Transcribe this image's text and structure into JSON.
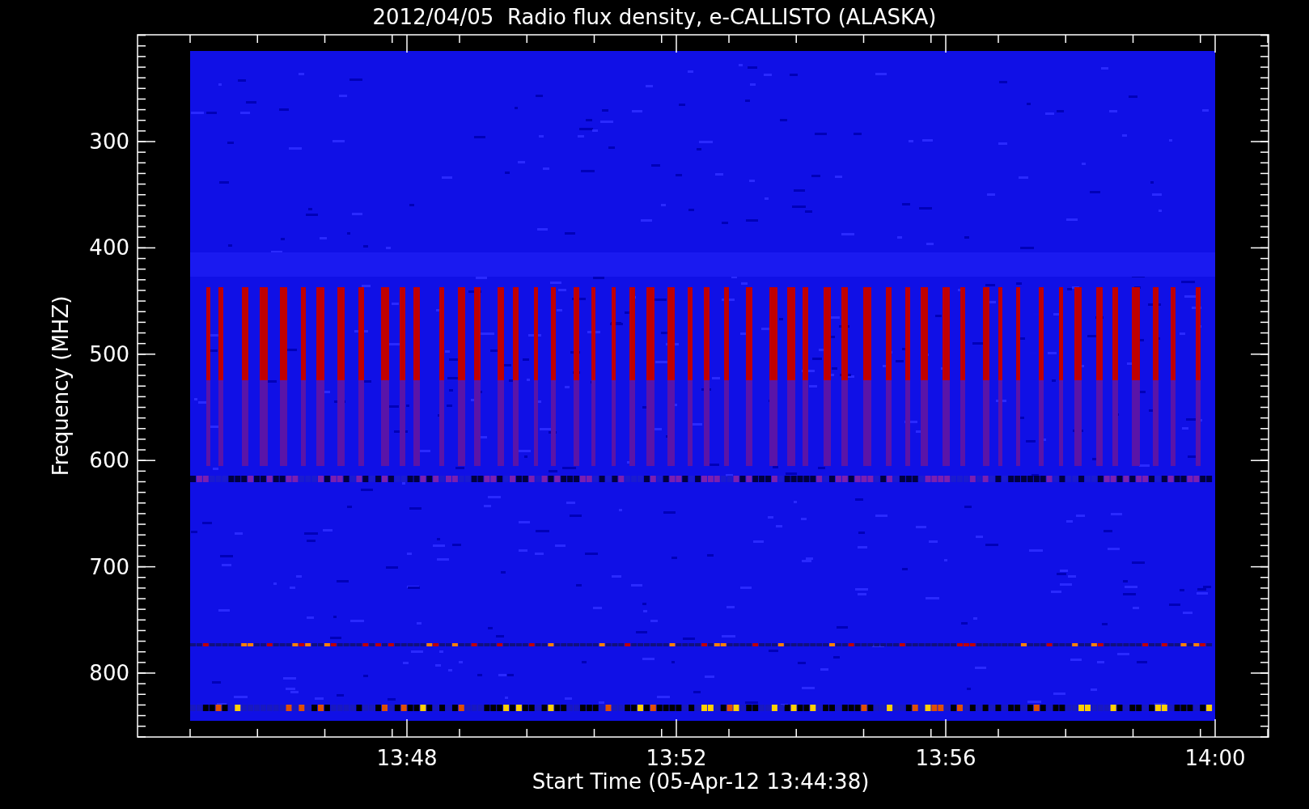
{
  "title": "2012/04/05  Radio flux density, e-CALLISTO (ALASKA)",
  "y_axis": {
    "label": "Frequency (MHZ)",
    "ticks": [
      "300",
      "400",
      "500",
      "600",
      "700",
      "800"
    ]
  },
  "x_axis": {
    "label": "Start Time (05-Apr-12 13:44:38)",
    "ticks": [
      "13:48",
      "13:52",
      "13:56",
      "14:00"
    ]
  }
}
